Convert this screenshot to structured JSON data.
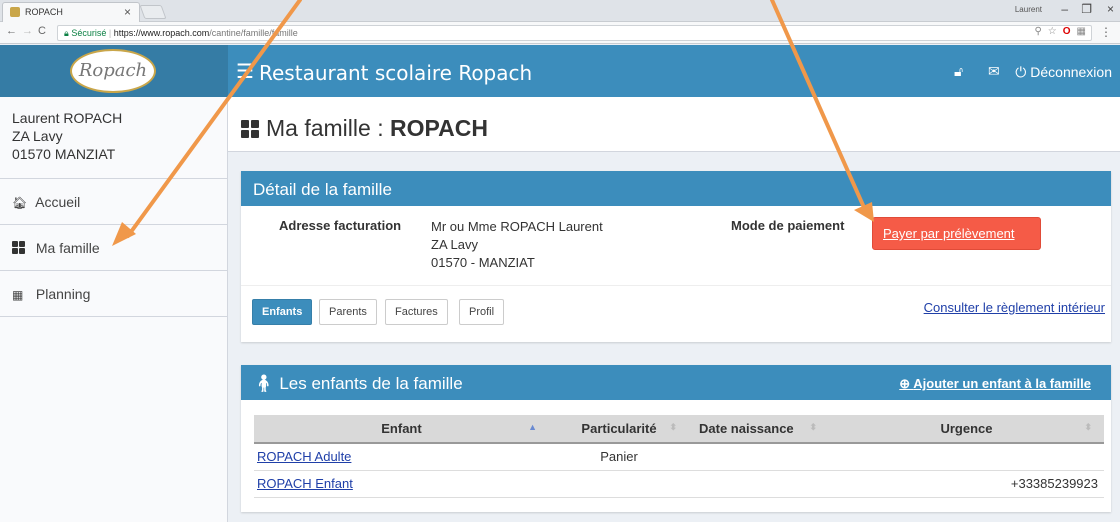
{
  "browser": {
    "tab_title": "ROPACH",
    "tab_close": "×",
    "user_chip": "Laurent",
    "url_secure": "Sécurisé",
    "url_host": "https://www.ropach.com",
    "url_path": "/cantine/famille/famille",
    "win_minimize": "–",
    "win_maximize": "❐",
    "win_close": "×"
  },
  "header": {
    "logo_text": "Ropach",
    "app_title": "Restaurant scolaire Ropach",
    "logout": "Déconnexion"
  },
  "sidebar": {
    "user_name": "Laurent ROPACH",
    "user_addr1": "ZA Lavy",
    "user_addr2": "01570 MANZIAT",
    "items": [
      {
        "label": "Accueil"
      },
      {
        "label": "Ma famille"
      },
      {
        "label": "Planning"
      }
    ]
  },
  "page": {
    "title_prefix": "Ma famille : ",
    "title_name": "ROPACH"
  },
  "detail": {
    "heading": "Détail de la famille",
    "billing_label": "Adresse facturation",
    "billing_line1": "Mr ou Mme ROPACH Laurent",
    "billing_line2": "ZA Lavy",
    "billing_line3": "01570 - MANZIAT",
    "payment_label": "Mode de paiement",
    "payment_button": "Payer par prélèvement",
    "tabs": [
      "Enfants",
      "Parents",
      "Factures",
      "Profil"
    ],
    "reglement_link": "Consulter le règlement intérieur"
  },
  "children": {
    "heading": "Les enfants de la famille",
    "add_link": "Ajouter un enfant à la famille",
    "columns": [
      "Enfant",
      "Particularité",
      "Date naissance",
      "Urgence"
    ],
    "rows": [
      {
        "enfant": "ROPACH Adulte",
        "particularite": "Panier",
        "date": "",
        "urgence": ""
      },
      {
        "enfant": "ROPACH Enfant",
        "particularite": "",
        "date": "",
        "urgence": "+33385239923"
      }
    ]
  },
  "colors": {
    "primary": "#3c8dbc",
    "primary_dark": "#357ca5",
    "danger": "#f55b47",
    "annotation": "#f0984a"
  }
}
